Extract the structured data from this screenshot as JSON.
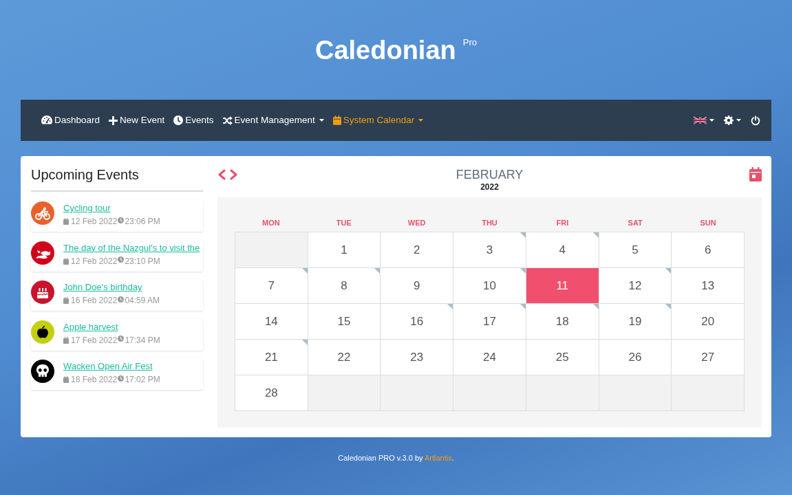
{
  "app": {
    "title": "Caledonian",
    "badge": "Pro"
  },
  "navbar": {
    "items": [
      {
        "label": "Dashboard",
        "selected": false,
        "dropdown": false
      },
      {
        "label": "New Event",
        "selected": false,
        "dropdown": false
      },
      {
        "label": "Events",
        "selected": false,
        "dropdown": false
      },
      {
        "label": "Event Management",
        "selected": false,
        "dropdown": true
      },
      {
        "label": "System Calendar",
        "selected": true,
        "dropdown": true
      }
    ]
  },
  "upcoming_events": {
    "title": "Upcoming Events",
    "events": [
      {
        "title": "Cycling tour",
        "date": "12 Feb 2022",
        "time": "23:06 PM",
        "color": "#e8612c"
      },
      {
        "title": "The day of the Nazgul's to visit the",
        "date": "12 Feb 2022",
        "time": "23:10 PM",
        "color": "#d0021b"
      },
      {
        "title": "John Doe's birthday",
        "date": "16 Feb 2022",
        "time": "04:59 AM",
        "color": "#c8142c"
      },
      {
        "title": "Apple harvest",
        "date": "17 Feb 2022",
        "time": "17:34 PM",
        "color": "#c3d010"
      },
      {
        "title": "Wacken Open Air Fest",
        "date": "18 Feb 2022",
        "time": "17:02 PM",
        "color": "#000000"
      }
    ]
  },
  "calendar": {
    "month": "FEBRUARY",
    "year": "2022",
    "weekdays": [
      "MON",
      "TUE",
      "WED",
      "THU",
      "FRI",
      "SAT",
      "SUN"
    ],
    "weeks": [
      [
        {
          "kind": "blank"
        },
        {
          "kind": "day",
          "day": "1",
          "selected": false,
          "has_events": false
        },
        {
          "kind": "day",
          "day": "2",
          "selected": false,
          "has_events": false
        },
        {
          "kind": "day",
          "day": "3",
          "selected": false,
          "has_events": true
        },
        {
          "kind": "day",
          "day": "4",
          "selected": false,
          "has_events": true
        },
        {
          "kind": "day",
          "day": "5",
          "selected": false,
          "has_events": false
        },
        {
          "kind": "day",
          "day": "6",
          "selected": false,
          "has_events": false
        }
      ],
      [
        {
          "kind": "day",
          "day": "7",
          "selected": false,
          "has_events": true
        },
        {
          "kind": "day",
          "day": "8",
          "selected": false,
          "has_events": true
        },
        {
          "kind": "day",
          "day": "9",
          "selected": false,
          "has_events": false
        },
        {
          "kind": "day",
          "day": "10",
          "selected": false,
          "has_events": true
        },
        {
          "kind": "day",
          "day": "11",
          "selected": true,
          "has_events": false
        },
        {
          "kind": "day",
          "day": "12",
          "selected": false,
          "has_events": true
        },
        {
          "kind": "day",
          "day": "13",
          "selected": false,
          "has_events": false
        }
      ],
      [
        {
          "kind": "day",
          "day": "14",
          "selected": false,
          "has_events": false
        },
        {
          "kind": "day",
          "day": "15",
          "selected": false,
          "has_events": false
        },
        {
          "kind": "day",
          "day": "16",
          "selected": false,
          "has_events": true
        },
        {
          "kind": "day",
          "day": "17",
          "selected": false,
          "has_events": true
        },
        {
          "kind": "day",
          "day": "18",
          "selected": false,
          "has_events": true
        },
        {
          "kind": "day",
          "day": "19",
          "selected": false,
          "has_events": true
        },
        {
          "kind": "day",
          "day": "20",
          "selected": false,
          "has_events": false
        }
      ],
      [
        {
          "kind": "day",
          "day": "21",
          "selected": false,
          "has_events": true
        },
        {
          "kind": "day",
          "day": "22",
          "selected": false,
          "has_events": false
        },
        {
          "kind": "day",
          "day": "23",
          "selected": false,
          "has_events": false
        },
        {
          "kind": "day",
          "day": "24",
          "selected": false,
          "has_events": false
        },
        {
          "kind": "day",
          "day": "25",
          "selected": false,
          "has_events": false
        },
        {
          "kind": "day",
          "day": "26",
          "selected": false,
          "has_events": false
        },
        {
          "kind": "day",
          "day": "27",
          "selected": false,
          "has_events": false
        }
      ],
      [
        {
          "kind": "day",
          "day": "28",
          "selected": false,
          "has_events": false
        },
        {
          "kind": "blank"
        },
        {
          "kind": "blank"
        },
        {
          "kind": "blank"
        },
        {
          "kind": "blank"
        },
        {
          "kind": "blank"
        },
        {
          "kind": "blank"
        }
      ]
    ]
  },
  "footer": {
    "text": "Caledonian PRO v.3.0 by",
    "link": "Artlantis",
    "end": "."
  }
}
